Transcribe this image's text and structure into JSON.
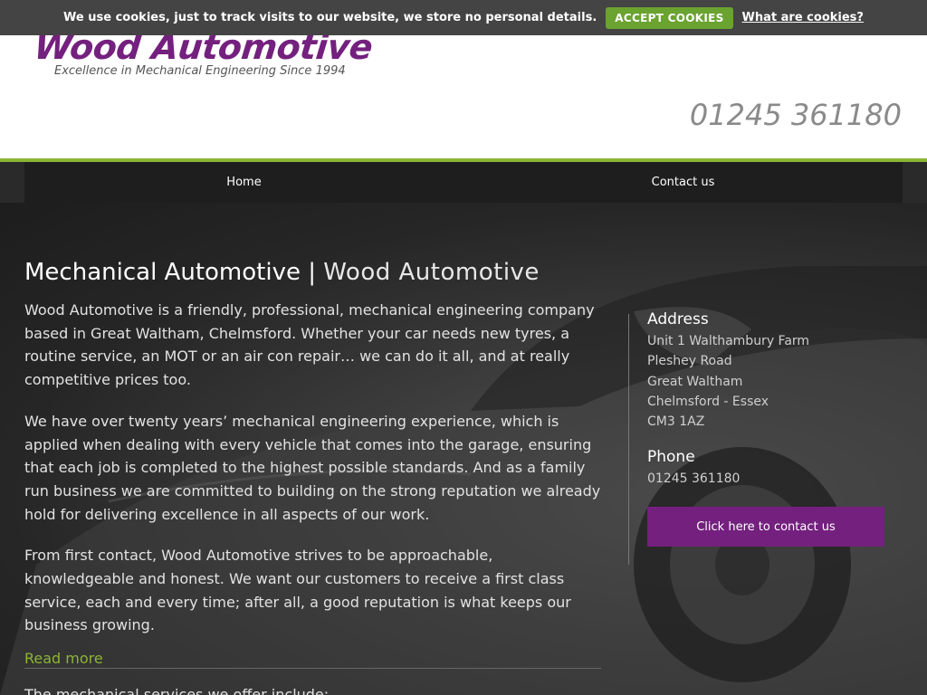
{
  "cookie_bar": {
    "message": "We use cookies, just to track visits to our website, we store no personal details.",
    "accept_label": "ACCEPT COOKIES",
    "info_link": "What are cookies?"
  },
  "header": {
    "logo_name": "Wood Automotive",
    "logo_tagline": "Excellence in Mechanical Engineering Since 1994",
    "phone": "01245 361180"
  },
  "nav": {
    "items": [
      {
        "label": "Home"
      },
      {
        "label": "Contact us"
      }
    ]
  },
  "main": {
    "title_bold": "Mechanical Automotive |",
    "title_light": "Wood Automotive",
    "paragraphs": [
      "Wood Automotive is a friendly, professional, mechanical engineering company based in Great Waltham, Chelmsford. Whether your car needs new tyres, a routine service, an MOT or an air con repair… we can do it all, and at really competitive prices too.",
      "We have over twenty years’ mechanical engineering experience, which is applied when dealing with every vehicle that comes into the garage, ensuring that each job is completed to the highest possible standards. And as a family run business we are committed to building on the strong reputation we already hold for delivering excellence in all aspects of our work.",
      "From first contact, Wood Automotive strives to be approachable, knowledgeable and honest. We want our customers to receive a first class service, each and every time; after all, a good reputation is what keeps our business growing."
    ],
    "read_more": "Read more",
    "partial_next": "The mechanical services we offer include:"
  },
  "sidebar": {
    "address_heading": "Address",
    "address_lines": [
      "Unit 1 Walthambury Farm",
      "Pleshey Road",
      "Great Waltham",
      "Chelmsford - Essex",
      "CM3 1AZ"
    ],
    "phone_heading": "Phone",
    "phone": "01245 361180",
    "contact_button": "Click here to contact us"
  },
  "colors": {
    "brand_purple": "#74207e",
    "accent_green": "#8cb534",
    "cookie_button": "#6aa330"
  }
}
